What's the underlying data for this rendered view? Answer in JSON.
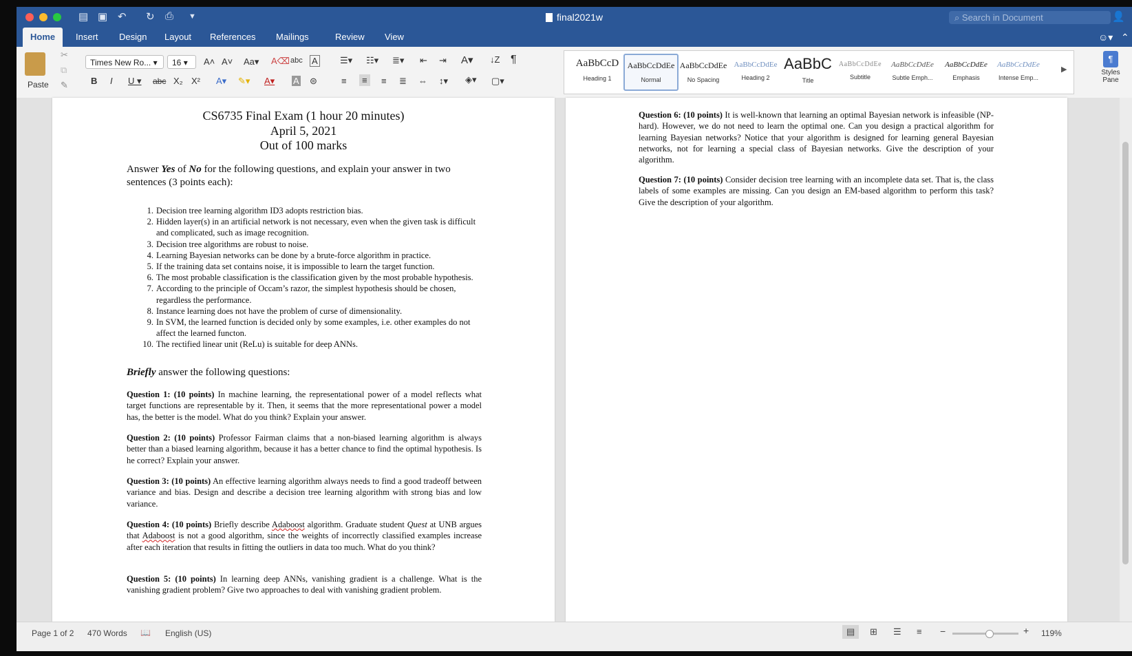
{
  "app": {
    "doc_title": "final2021w",
    "search_placeholder": "Search in Document"
  },
  "tabs": [
    "Home",
    "Insert",
    "Design",
    "Layout",
    "References",
    "Mailings",
    "Review",
    "View"
  ],
  "ribbon": {
    "paste_label": "Paste",
    "font_name": "Times New Ro...",
    "font_size": "16",
    "styles_pane_label": "Styles Pane",
    "styles": [
      {
        "preview": "AaBbCcD",
        "name": "Heading 1"
      },
      {
        "preview": "AaBbCcDdEe",
        "name": "Normal"
      },
      {
        "preview": "AaBbCcDdEe",
        "name": "No Spacing"
      },
      {
        "preview": "AaBbCcDdEe",
        "name": "Heading 2"
      },
      {
        "preview": "AaBbC",
        "name": "Title"
      },
      {
        "preview": "AaBbCcDdEe",
        "name": "Subtitle"
      },
      {
        "preview": "AaBbCcDdEe",
        "name": "Subtle Emph..."
      },
      {
        "preview": "AaBbCcDdEe",
        "name": "Emphasis"
      },
      {
        "preview": "AaBbCcDdEe",
        "name": "Intense Emp..."
      }
    ]
  },
  "document": {
    "title_lines": [
      "CS6735 Final Exam (1 hour 20 minutes)",
      "April 5, 2021",
      "Out of 100 marks"
    ],
    "intro": {
      "pre": "Answer ",
      "yes": "Yes",
      "mid": " of ",
      "no": "No",
      "post": " for the following questions, and explain your answer in two sentences (3 points each):"
    },
    "tf_questions": [
      "Decision tree learning algorithm ID3 adopts restriction bias.",
      "Hidden layer(s) in an artificial network is not necessary, even when the given task is difficult and complicated, such as image recognition.",
      "Decision tree algorithms are robust to noise.",
      "Learning Bayesian networks can be done by a brute-force algorithm in practice.",
      "If the training data set contains noise, it is impossible to learn the target function.",
      "The most probable classification is the classification given by the most probable hypothesis.",
      "According to the principle of Occam’s razor, the simplest hypothesis should be chosen, regardless the performance.",
      "Instance learning does not have the problem of curse of dimensionality.",
      "In SVM, the learned function is decided only by some examples, i.e. other examples do not affect the learned functon.",
      "The rectified linear unit (ReLu) is suitable for deep ANNs."
    ],
    "briefly": {
      "em": "Briefly",
      "rest": " answer the following questions:"
    },
    "questions": [
      {
        "label": "Question 1: (10 points)",
        "text": " In machine learning, the representational power of a model reflects what target functions are representable by it. Then, it seems that the more representational power a model has, the better is the model. What do you think? Explain your answer."
      },
      {
        "label": "Question 2: (10 points)",
        "text": " Professor Fairman claims that a non-biased learning algorithm is always better than a biased learning algorithm, because it has a better chance to find the optimal hypothesis. Is he correct? Explain your answer."
      },
      {
        "label": "Question 3: (10 points)",
        "text": " An effective learning algorithm always needs to find a good tradeoff between variance and bias. Design and describe a decision tree learning algorithm with strong bias and low variance."
      },
      {
        "label": "Question 4: (10 points)",
        "text_a": " Briefly describe ",
        "adaboost": "Adaboost",
        "text_b": " algorithm.  Graduate student ",
        "quest": "Quest",
        "text_c": " at UNB argues that ",
        "text_d": " is not a good algorithm, since the weights of incorrectly classified examples increase after each iteration that results in fitting the outliers in data too much. What do you think?"
      },
      {
        "label": "Question 5: (10 points)",
        "text": " In learning deep ANNs, vanishing gradient is a challenge. What is the vanishing gradient problem? Give two approaches to deal with vanishing gradient problem."
      },
      {
        "label": "Question 6: (10 points)",
        "text": " It is well-known that learning an optimal Bayesian network is infeasible (NP-hard). However, we do not need to learn the optimal one. Can you design a practical algorithm for learning Bayesian networks? Notice that your algorithm is designed for learning general Bayesian networks, not for learning a special class of Bayesian networks. Give the description of your algorithm."
      },
      {
        "label": "Question 7: (10 points)",
        "text": " Consider decision tree learning with an incomplete data set. That is, the class labels of some examples are missing. Can you design an EM-based algorithm to perform this task? Give the description of your algorithm."
      }
    ]
  },
  "status": {
    "page": "Page 1 of 2",
    "words": "470 Words",
    "language": "English (US)",
    "zoom": "119%",
    "zoom_level": 0.55
  }
}
